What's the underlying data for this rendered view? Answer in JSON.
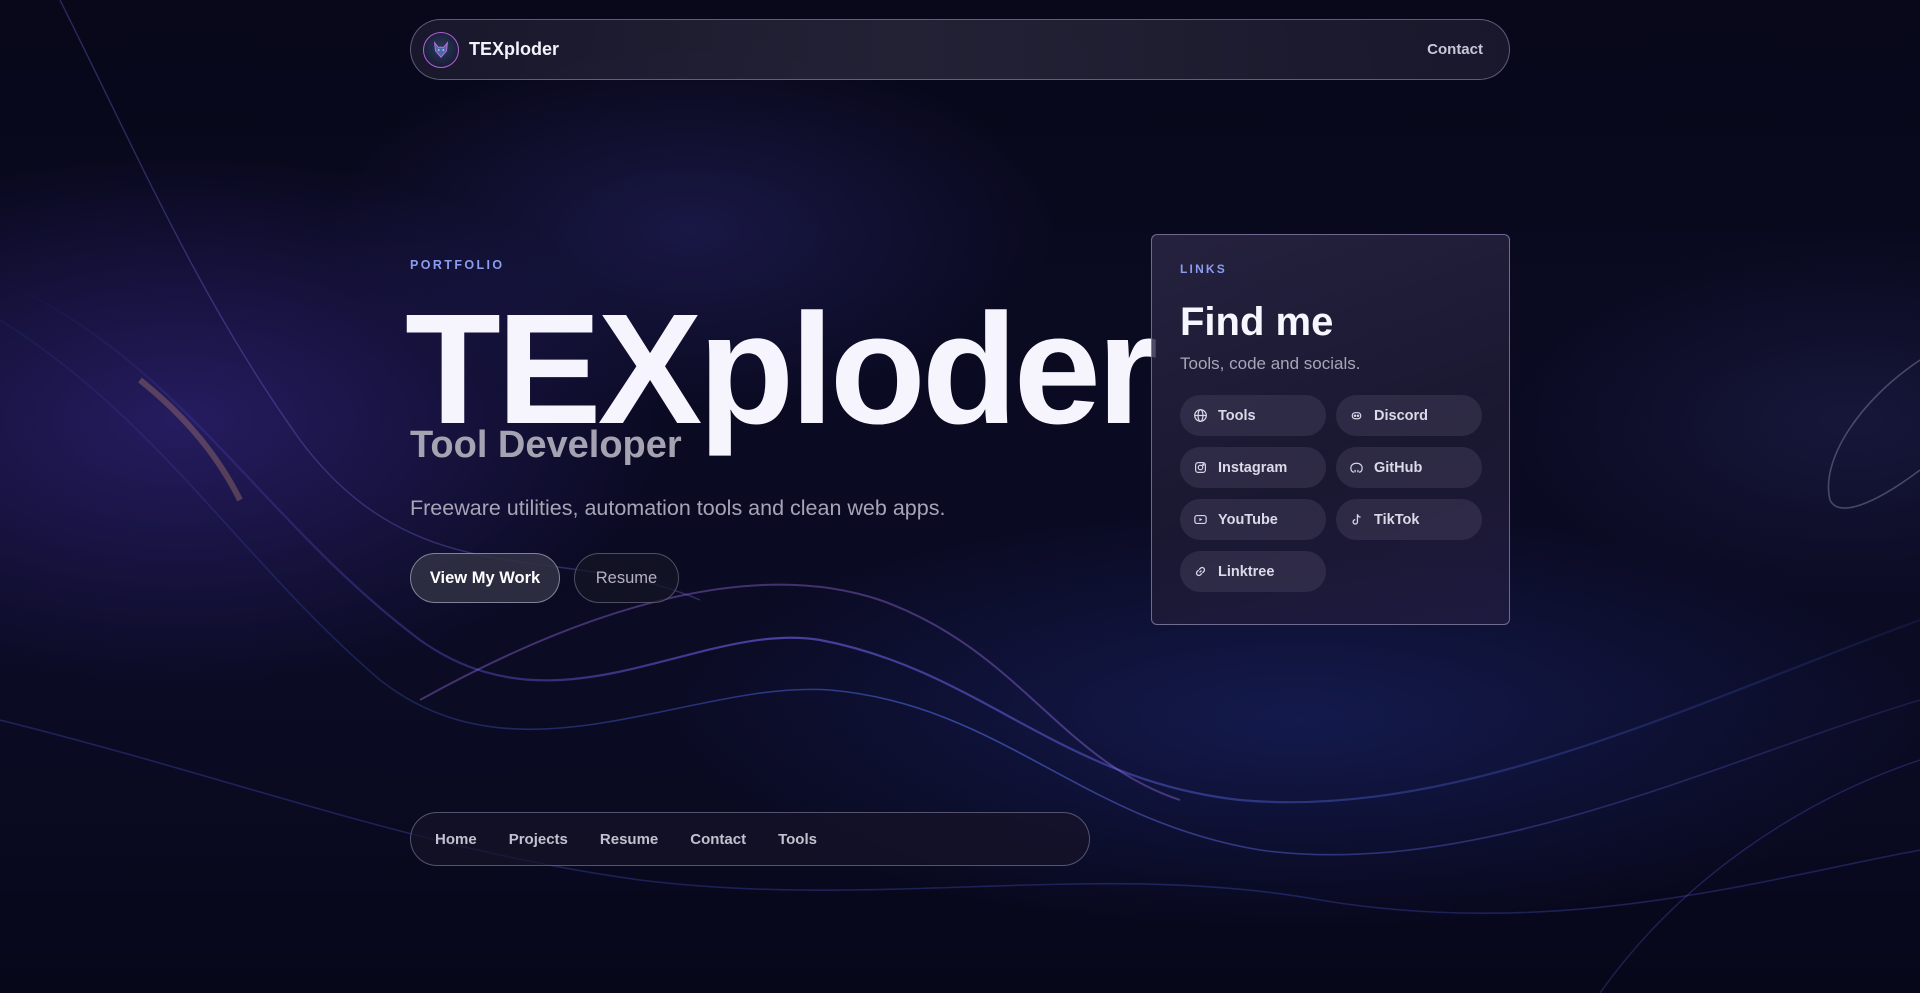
{
  "header": {
    "brand": "TEXploder",
    "logo_icon": "wolf-logo-icon",
    "contact_label": "Contact"
  },
  "hero": {
    "eyebrow": "PORTFOLIO",
    "title": "TEXploder",
    "role": "Tool Developer",
    "description": "Freeware utilities, automation tools and clean web apps.",
    "primary_button": "View My Work",
    "secondary_button": "Resume"
  },
  "links_card": {
    "eyebrow": "LINKS",
    "title": "Find me",
    "subtitle": "Tools, code and socials.",
    "items": [
      {
        "label": "Tools",
        "icon": "globe-icon"
      },
      {
        "label": "Discord",
        "icon": "discord-icon"
      },
      {
        "label": "Instagram",
        "icon": "instagram-icon"
      },
      {
        "label": "GitHub",
        "icon": "github-icon"
      },
      {
        "label": "YouTube",
        "icon": "youtube-icon"
      },
      {
        "label": "TikTok",
        "icon": "tiktok-icon"
      },
      {
        "label": "Linktree",
        "icon": "link-icon"
      }
    ]
  },
  "bottom_nav": {
    "items": [
      "Home",
      "Projects",
      "Resume",
      "Contact",
      "Tools"
    ]
  },
  "colors": {
    "accent": "#8a9df0",
    "logo_ring": "#b060d8",
    "background": "#0a0a22"
  }
}
